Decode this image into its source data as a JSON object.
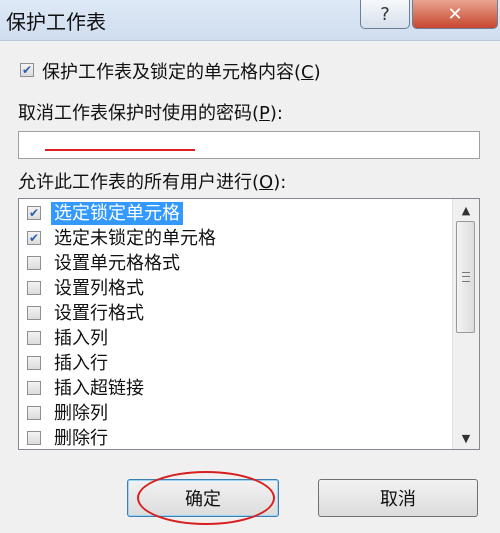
{
  "window": {
    "title": "保护工作表",
    "help_glyph": "?",
    "close_glyph": "✕"
  },
  "protect_option": {
    "checked": true,
    "label": "保护工作表及锁定的单元格内容(",
    "hotkey": "C",
    "tail": ")"
  },
  "password": {
    "label": "取消工作表保护时使用的密码(",
    "hotkey": "P",
    "tail": "):",
    "value": ""
  },
  "permissions": {
    "label": "允许此工作表的所有用户进行(",
    "hotkey": "O",
    "tail": "):",
    "items": [
      {
        "label": "选定锁定单元格",
        "checked": true,
        "selected": true
      },
      {
        "label": "选定未锁定的单元格",
        "checked": true,
        "selected": false
      },
      {
        "label": "设置单元格格式",
        "checked": false,
        "selected": false
      },
      {
        "label": "设置列格式",
        "checked": false,
        "selected": false
      },
      {
        "label": "设置行格式",
        "checked": false,
        "selected": false
      },
      {
        "label": "插入列",
        "checked": false,
        "selected": false
      },
      {
        "label": "插入行",
        "checked": false,
        "selected": false
      },
      {
        "label": "插入超链接",
        "checked": false,
        "selected": false
      },
      {
        "label": "删除列",
        "checked": false,
        "selected": false
      },
      {
        "label": "删除行",
        "checked": false,
        "selected": false
      }
    ]
  },
  "buttons": {
    "ok_label": "确定",
    "cancel_label": "取消"
  },
  "colors": {
    "selection": "#3399ff",
    "annotation_red": "#d81f1f",
    "check": "#2b5fab"
  }
}
